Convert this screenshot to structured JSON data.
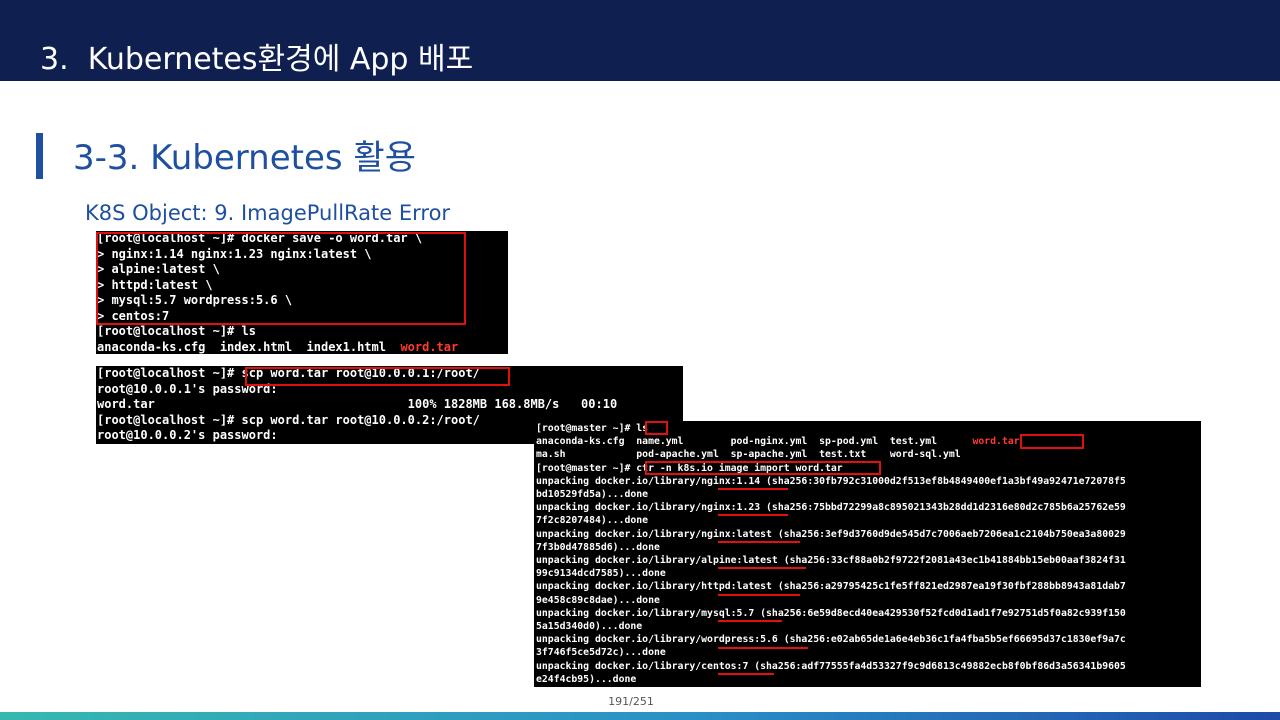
{
  "header": {
    "title": "3.  Kubernetes환경에 App 배포"
  },
  "section": {
    "title": "3-3. Kubernetes 활용",
    "subtitle": "K8S Object: 9. ImagePullRate Error"
  },
  "terminal_1": {
    "lines": [
      "[root@localhost ~]# docker save -o word.tar \\",
      "> nginx:1.14 nginx:1.23 nginx:latest \\",
      "> alpine:latest \\",
      "> httpd:latest \\",
      "> mysql:5.7 wordpress:5.6 \\",
      "> centos:7",
      "[root@localhost ~]# ls"
    ],
    "ls_output": "anaconda-ks.cfg  index.html  index1.html  ",
    "ls_highlight": "word.tar"
  },
  "terminal_2": {
    "lines": [
      "[root@localhost ~]# scp word.tar root@10.0.0.1:/root/",
      "root@10.0.0.1's password:",
      "word.tar                                   100% 1828MB 168.8MB/s   00:10",
      "[root@localhost ~]# scp word.tar root@10.0.0.2:/root/",
      "root@10.0.0.2's password:"
    ]
  },
  "terminal_3": {
    "line_ls": "[root@master ~]# ls",
    "ls_row1": "anaconda-ks.cfg  name.yml        pod-nginx.yml  sp-pod.yml  test.yml      ",
    "ls_row1_highlight": "word.tar",
    "ls_row2": "ma.sh            pod-apache.yml  sp-apache.yml  test.txt    word-sql.yml",
    "import_cmd": "[root@master ~]# ctr -n k8s.io image import word.tar",
    "lines": [
      "unpacking docker.io/library/nginx:1.14 (sha256:30fb792c31000d2f513ef8b4849400ef1a3bf49a92471e72078f5",
      "bd10529fd5a)...done",
      "unpacking docker.io/library/nginx:1.23 (sha256:75bbd72299a8c895021343b28dd1d2316e80d2c785b6a25762e59",
      "7f2c8207484)...done",
      "unpacking docker.io/library/nginx:latest (sha256:3ef9d3760d9de545d7c7006aeb7206ea1c2104b750ea3a80029",
      "7f3b0d47885d6)...done",
      "unpacking docker.io/library/alpine:latest (sha256:33cf88a0b2f9722f2081a43ec1b41884bb15eb00aaf3824f31",
      "99c9134dcd7585)...done",
      "unpacking docker.io/library/httpd:latest (sha256:a29795425c1fe5ff821ed2987ea19f30fbf288bb8943a81dab7",
      "9e458c89c8dae)...done",
      "unpacking docker.io/library/mysql:5.7 (sha256:6e59d8ecd40ea429530f52fcd0d1ad1f7e92751d5f0a82c939f150",
      "5a15d340d0)...done",
      "unpacking docker.io/library/wordpress:5.6 (sha256:e02ab65de1a6e4eb36c1fa4fba5b5ef66695d37c1830ef9a7c",
      "3f746f5ce5d72c)...done",
      "unpacking docker.io/library/centos:7 (sha256:adf77555fa4d53327f9c9d6813c49882ecb8f0bf86d3a56341b9605",
      "e24f4cb95)...done"
    ]
  },
  "footer": {
    "page": "191/251"
  },
  "colors": {
    "header_bg": "#0f1f4f",
    "accent": "#1e4fa0",
    "highlight": "#e01010"
  }
}
